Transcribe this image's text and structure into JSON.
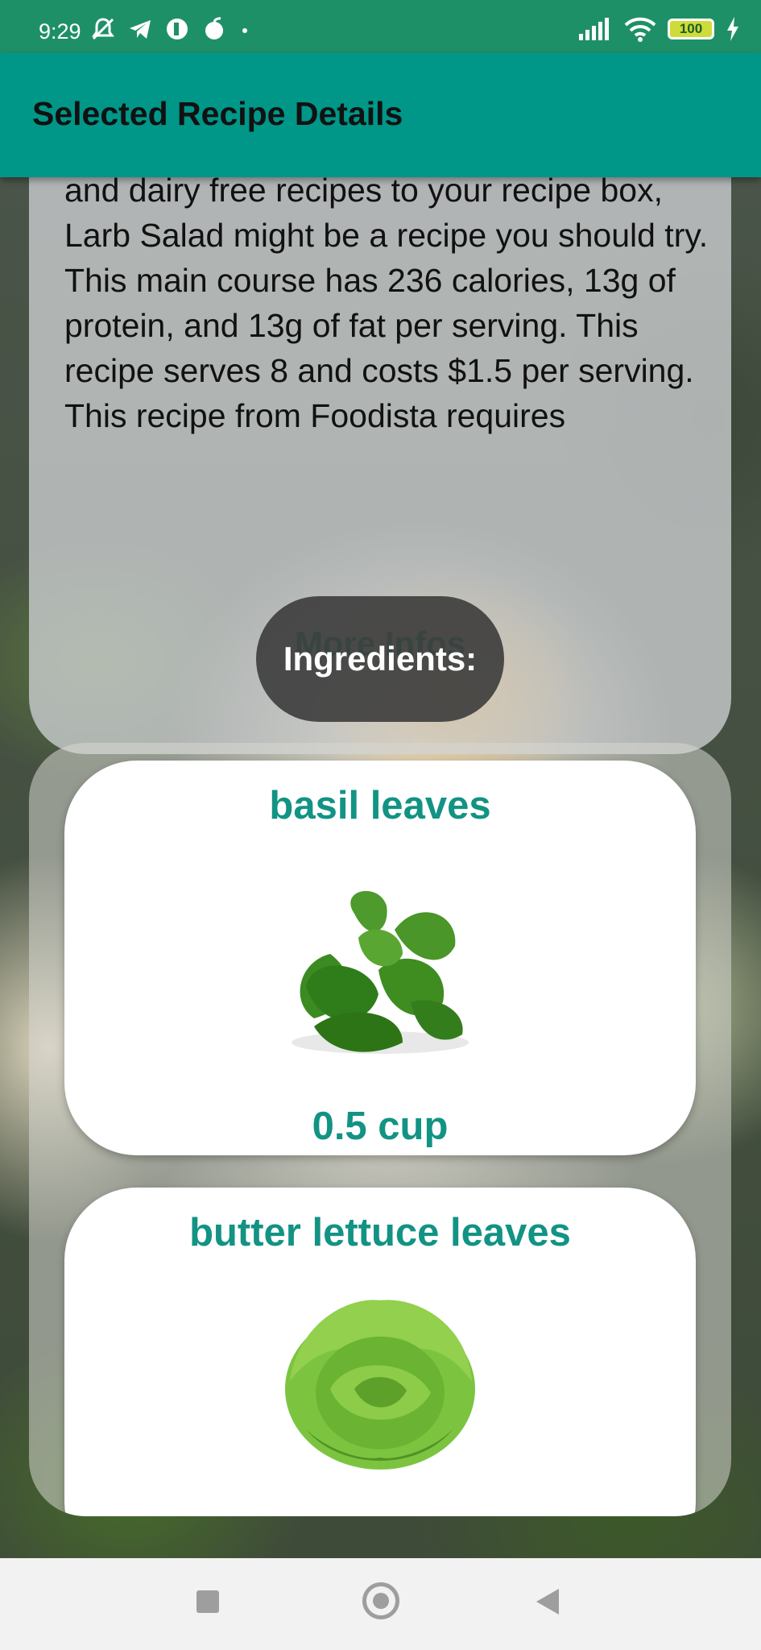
{
  "status_bar": {
    "time": "9:29",
    "battery": "100"
  },
  "app_bar": {
    "title": "Selected Recipe Details"
  },
  "summary": {
    "text_partial_top": "and dairy free recipes to your recipe",
    "text": "box, Larb Salad might be a recipe you should try. This main course has 236 calories, 13g of protein, and 13g of fat per serving. This recipe serves 8 and costs $1.5 per serving. This recipe from Foodista requires",
    "more_button": "More Infos"
  },
  "ingredients": {
    "header": "Ingredients:",
    "items": [
      {
        "name": "basil leaves",
        "amount": "0.5 cup",
        "icon": "basil-icon"
      },
      {
        "name": "butter lettuce leaves",
        "amount": "",
        "icon": "lettuce-icon"
      }
    ]
  },
  "colors": {
    "status_bar": "#1e9068",
    "app_bar": "#009688",
    "accent_text": "#129384",
    "more_infos": "#1e8a6d"
  }
}
